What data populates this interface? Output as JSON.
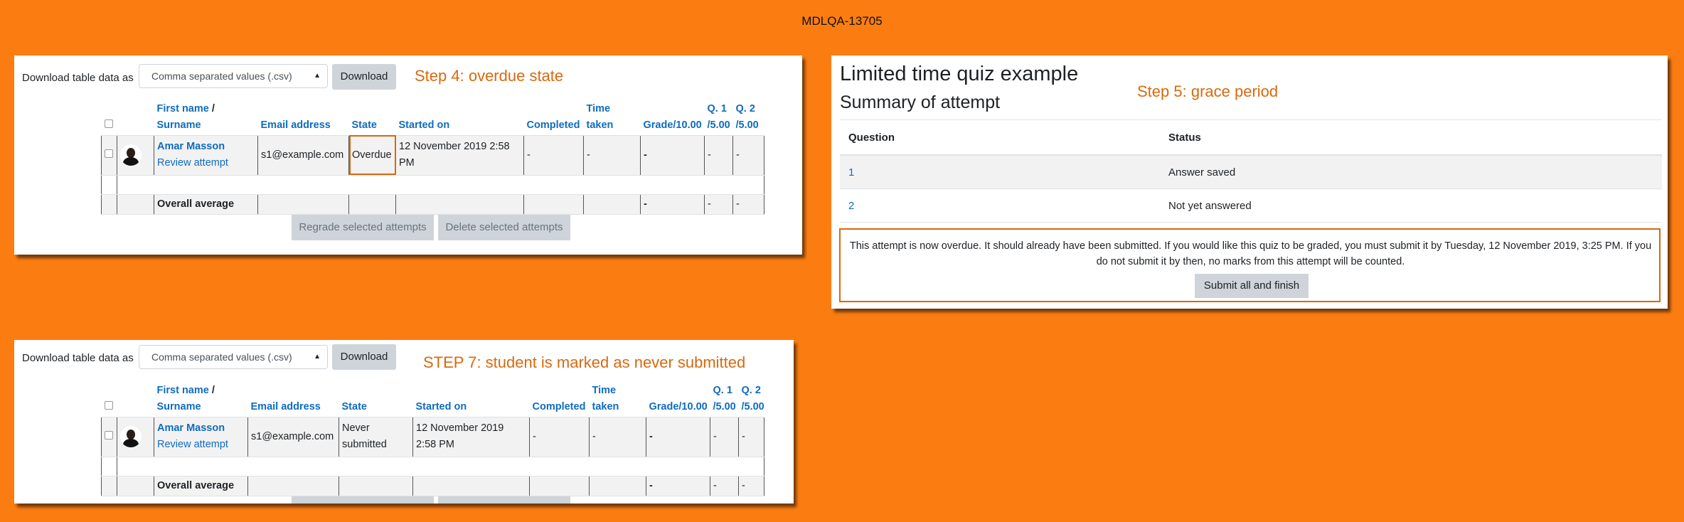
{
  "page_title": "MDLQA-13705",
  "colors": {
    "background": "#fb7d12",
    "annotation": "#d9690c",
    "link": "#0f6cbf"
  },
  "step4": {
    "download_label": "Download table data as",
    "format_select": "Comma separated values (.csv)",
    "download_button": "Download",
    "step_label": "Step 4: overdue state",
    "headers": {
      "first_name": "First name",
      "slash": " /",
      "surname": "Surname",
      "email": "Email address",
      "state": "State",
      "started_on": "Started on",
      "completed": "Completed",
      "time_taken": "Time taken",
      "grade": "Grade/10.00",
      "q1": "Q. 1 /5.00",
      "q2": "Q. 2 /5.00"
    },
    "row": {
      "name": "Amar Masson",
      "review": "Review attempt",
      "email": "s1@example.com",
      "state": "Overdue",
      "started_on": "12 November 2019 2:58 PM",
      "completed": "-",
      "time_taken": "-",
      "grade": "-",
      "q1": "-",
      "q2": "-"
    },
    "average": {
      "label": "Overall average",
      "grade": "-",
      "q1": "-",
      "q2": "-"
    },
    "regrade_button": "Regrade selected attempts",
    "delete_button": "Delete selected attempts"
  },
  "step7": {
    "download_label": "Download table data as",
    "format_select": "Comma separated values (.csv)",
    "download_button": "Download",
    "step_label": "STEP 7: student is marked as never submitted",
    "headers": {
      "first_name": "First name",
      "slash": " /",
      "surname": "Surname",
      "email": "Email address",
      "state": "State",
      "started_on": "Started on",
      "completed": "Completed",
      "time_taken": "Time taken",
      "grade": "Grade/10.00",
      "q1": "Q. 1 /5.00",
      "q2": "Q. 2 /5.00"
    },
    "row": {
      "name": "Amar Masson",
      "review": "Review attempt",
      "email": "s1@example.com",
      "state": "Never submitted",
      "started_on": "12 November 2019 2:58 PM",
      "completed": "-",
      "time_taken": "-",
      "grade": "-",
      "q1": "-",
      "q2": "-"
    },
    "average": {
      "label": "Overall average",
      "grade": "-",
      "q1": "-",
      "q2": "-"
    }
  },
  "step5": {
    "quiz_title": "Limited time quiz example",
    "subtitle": "Summary of attempt",
    "step_label": "Step 5: grace period",
    "col_question": "Question",
    "col_status": "Status",
    "rows": [
      {
        "question": "1",
        "status": "Answer saved"
      },
      {
        "question": "2",
        "status": "Not yet answered"
      }
    ],
    "overdue_message": "This attempt is now overdue. It should already have been submitted. If you would like this quiz to be graded, you must submit it by Tuesday, 12 November 2019, 3:25 PM. If you do not submit it by then, no marks from this attempt will be counted.",
    "submit_button": "Submit all and finish"
  }
}
